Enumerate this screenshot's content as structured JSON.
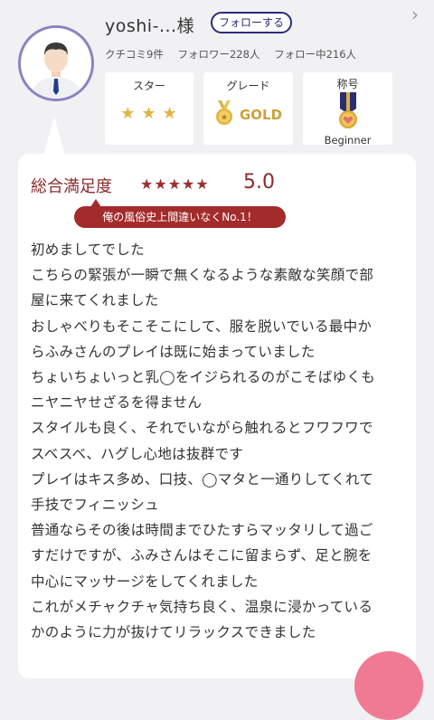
{
  "profile": {
    "username": "yoshi-...様",
    "follow_label": "フォローする",
    "stats": [
      "クチコミ9件",
      "フォロワー228人",
      "フォロー中216人"
    ],
    "avatar_icon": "user-avatar-icon"
  },
  "cards": {
    "star": {
      "title": "スター",
      "value": 3,
      "max": 3
    },
    "grade": {
      "title": "グレード",
      "value": "GOLD",
      "icon": "gold-medal-icon"
    },
    "title_badge": {
      "title": "称号",
      "value": "Beginner",
      "icon": "ribbon-medal-icon"
    }
  },
  "review": {
    "overall_label": "総合満足度",
    "rating": 5,
    "score": "5.0",
    "catchphrase": "俺の風俗史上間違いなくNo.1！",
    "lines": [
      "初めましてでした",
      "こちらの緊張が一瞬で無くなるような素敵な笑顔で部",
      "屋に来てくれました",
      "おしゃべりもそこそこにして、服を脱いでいる最中か",
      "らふみさんのプレイは既に始まっていました",
      "ちょいちょいっと乳◯をイジられるのがこそばゆくも",
      "ニヤニヤせざるを得ません",
      "スタイルも良く、それでいながら触れるとフワフワで",
      "スベスベ、ハグし心地は抜群です",
      "プレイはキス多め、口技、◯マタと一通りしてくれて",
      "手技でフィニッシュ",
      "普通ならその後は時間までひたすらマッタリして過ご",
      "すだけですが、ふみさんはそこに留まらず、足と腕を",
      "中心にマッサージをしてくれました",
      "これがメチャクチャ気持ち良く、温泉に浸かっている",
      "かのように力が抜けてリラックスできました"
    ]
  },
  "colors": {
    "accent_red": "#8b2b2b",
    "follow_navy": "#2b2b7a",
    "gold": "#c9a23a",
    "fab_pink": "#f07a93"
  }
}
